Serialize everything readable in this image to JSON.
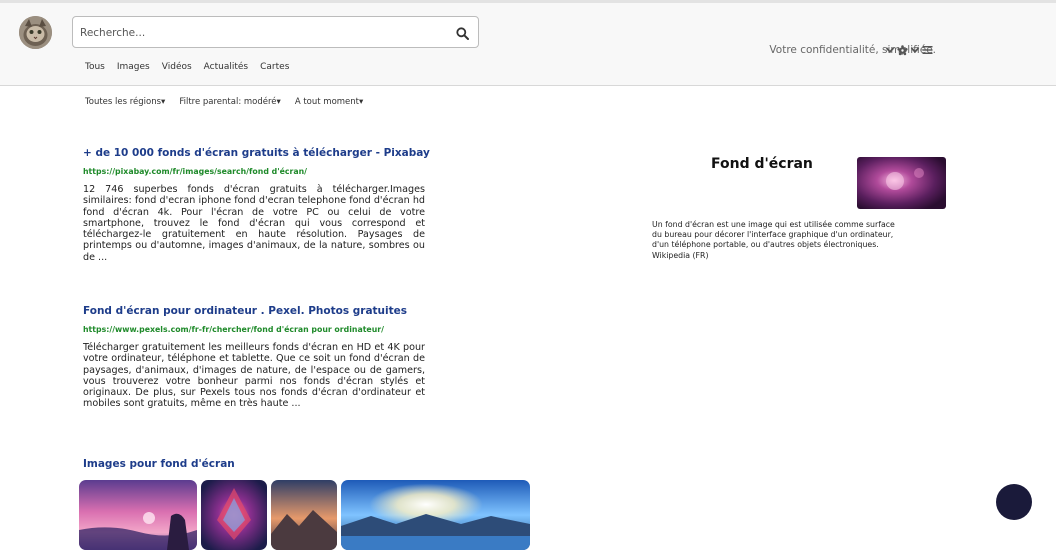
{
  "search": {
    "placeholder": "Recherche..."
  },
  "nav": {
    "tabs": [
      "Tous",
      "Images",
      "Vidéos",
      "Actualités",
      "Cartes"
    ]
  },
  "header": {
    "privacy_text": "Votre confidentialité, simplifiée."
  },
  "filters": [
    "Toutes les régions▾",
    "Filtre parental: modéré▾",
    "A tout moment▾"
  ],
  "results": [
    {
      "title": "+ de 10 000 fonds d'écran gratuits à télécharger - Pixabay",
      "url": "https://pixabay.com/fr/images/search/fond d'écran/",
      "snippet": "12 746 superbes fonds d'écran gratuits à télécharger.Images similaires: fond d'ecran iphone fond d'ecran telephone fond d'écran hd fond d'écran 4k. Pour l'écran de votre PC ou celui de votre smartphone, trouvez le fond d'écran qui vous correspond et téléchargez-le gratuitement en haute résolution. Paysages de printemps ou d'automne, images d'animaux, de la nature, sombres ou de ..."
    },
    {
      "title": "Fond d'écran pour ordinateur . Pexel. Photos gratuites",
      "url": "https://www.pexels.com/fr-fr/chercher/fond d'écran pour ordinateur/",
      "snippet": "Télécharger gratuitement les meilleurs fonds d'écran en HD et 4K pour votre ordinateur, téléphone et tablette. Que ce soit un fond d'écran de paysages, d'animaux, d'images de nature, de l'espace ou de gamers, vous trouverez votre bonheur parmi nos fonds d'écran stylés et originaux. De plus, sur Pexels tous nos fonds d'écran d'ordinateur et mobiles sont gratuits, même en très haute ..."
    }
  ],
  "images_section": {
    "title": "Images pour fond d'écran"
  },
  "knowledge_panel": {
    "title": "Fond d'écran",
    "description": "Un fond d'écran est une image qui est utilisée comme surface du bureau pour décorer l'interface graphique d'un ordinateur, d'un téléphone portable, ou d'autres objets électroniques. Wikipedia (FR)"
  },
  "icons": [
    "search-icon",
    "chevron-down-icon",
    "settings-gear-icon",
    "menu-icon",
    "chat-icon"
  ],
  "colors": {
    "link_title": "#1d3c8a",
    "url_green": "#1f8a2a",
    "header_bg": "#f8f8f8",
    "chat_bubble": "#1a1a3a"
  }
}
